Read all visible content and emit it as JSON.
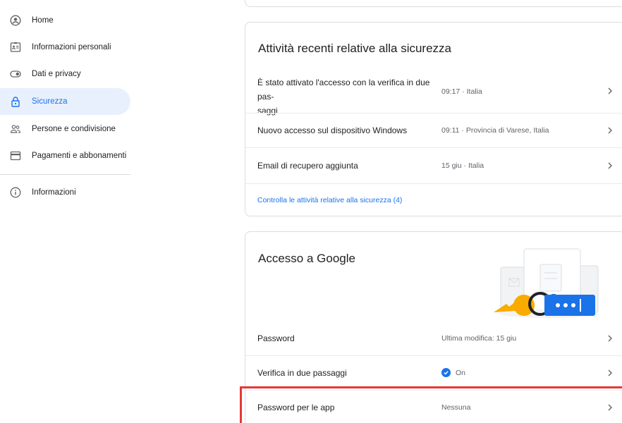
{
  "sidebar": {
    "items": [
      {
        "label": "Home",
        "icon": "account-circle-icon"
      },
      {
        "label": "Informazioni personali",
        "icon": "id-card-icon"
      },
      {
        "label": "Dati e privacy",
        "icon": "toggle-icon"
      },
      {
        "label": "Sicurezza",
        "icon": "lock-icon"
      },
      {
        "label": "Persone e condivisione",
        "icon": "people-icon"
      },
      {
        "label": "Pagamenti e abbonamenti",
        "icon": "credit-card-icon"
      },
      {
        "label": "Informazioni",
        "icon": "info-icon"
      }
    ],
    "active": "Sicurezza"
  },
  "activity": {
    "title": "Attività recenti relative alla sicurezza",
    "rows": [
      {
        "label": "È stato attivato l'accesso con la verifica in due pas-\nsaggi",
        "value": "09:17 · Italia"
      },
      {
        "label": "Nuovo accesso sul dispositivo Windows",
        "value": "09:11 · Provincia di Varese, Italia"
      },
      {
        "label": "Email di recupero aggiunta",
        "value": "15 giu · Italia"
      }
    ],
    "link": "Controlla le attività relative alla sicurezza (4)"
  },
  "access": {
    "title": "Accesso a Google",
    "rows": [
      {
        "label": "Password",
        "value": "Ultima modifica: 15 giu"
      },
      {
        "label": "Verifica in due passaggi",
        "value": "On"
      },
      {
        "label": "Password per le app",
        "value": "Nessuna"
      }
    ],
    "illustration_text": "**"
  },
  "colors": {
    "accent": "#1a73e8",
    "active_bg": "#e8f0fe",
    "highlight": "#e53935",
    "key": "#f9ab00"
  }
}
